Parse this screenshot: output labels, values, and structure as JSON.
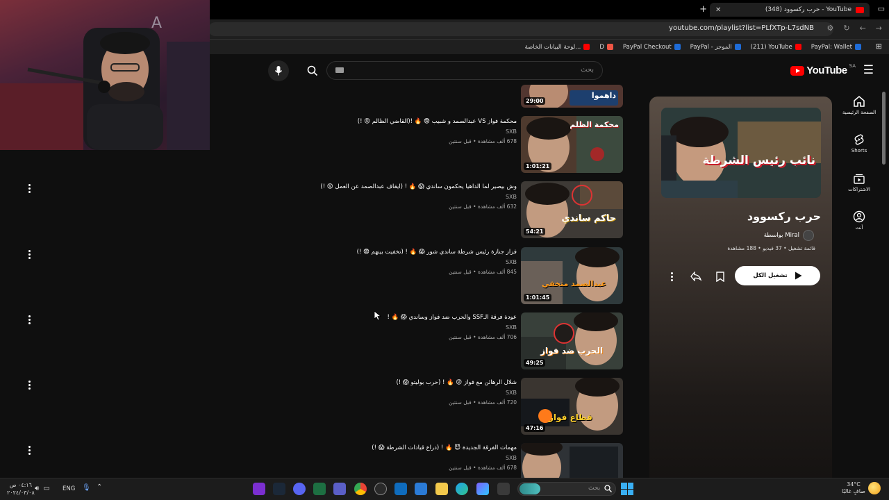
{
  "browser": {
    "tab_title": "YouTube - حرب ركسوود (348)",
    "url": "youtube.com/playlist?list=PLfXTp-L7sdNB",
    "bookmarks": [
      {
        "label": "PayPal: Wallet",
        "color": "#1e6bd6"
      },
      {
        "label": "(211) YouTube",
        "color": "#ff0000"
      },
      {
        "label": "PayPal - الموجز",
        "color": "#1e6bd6"
      },
      {
        "label": "PayPal Checkout",
        "color": "#1e6bd6"
      },
      {
        "label": "D",
        "color": "#e54"
      },
      {
        "label": "لوحة البيانات الخاصة...",
        "color": "#ff0000"
      }
    ]
  },
  "header": {
    "logo_text": "YouTube",
    "region": "SA",
    "search_placeholder": "بحث"
  },
  "nav_rail": [
    {
      "label": "الصفحة الرئيسية",
      "icon": "home-icon"
    },
    {
      "label": "Shorts",
      "icon": "shorts-icon"
    },
    {
      "label": "الاشتراكات",
      "icon": "subscriptions-icon"
    },
    {
      "label": "أنت",
      "icon": "you-icon"
    }
  ],
  "playlist": {
    "title": "حرب ركسوود",
    "owner": "بواسطة Miral",
    "meta": "قائمة تشغيل • 37 فيديو • 188 مشاهدة",
    "play_all": "تشغيل الكل",
    "thumb_caption": "نائب رئيس الشرطة"
  },
  "videos": [
    {
      "title": "",
      "channel": "",
      "meta": "",
      "duration": "29:00",
      "overlay": "داهموا"
    },
    {
      "title": "محكمة فواز VS عبدالصمد و شبيب 😨 🔥 !(القاضي الظالم 😡 !)",
      "channel": "SXB",
      "meta": "678 ألف مشاهدة • قبل سنتين",
      "duration": "1:01:21",
      "overlay": "محكمة الظلم"
    },
    {
      "title": "وش بيصير لما الداهيا يحكمون ساندي 😱 🔥 ! (ايقاف عبدالصمد عن العمل 😡 !)",
      "channel": "SXB",
      "meta": "632 ألف مشاهدة • قبل سنتين",
      "duration": "54:21",
      "overlay": "حاكم ساندي"
    },
    {
      "title": "فزاز جنازة رئيس شرطة ساندي شور 😱 🔥 ! (تخفيت بينهم 😨 !)",
      "channel": "SXB",
      "meta": "845 ألف مشاهدة • قبل سنتين",
      "duration": "1:01:45",
      "overlay": "عبدالصمد متخفي"
    },
    {
      "title": "عودة فرقة الـSSF والحرب ضد فواز وساندي 😱 🔥 !",
      "channel": "SXB",
      "meta": "706 ألف مشاهدة • قبل سنتين",
      "duration": "49:25",
      "overlay": "الحرب ضد فواز"
    },
    {
      "title": "شلال الرهائن مع فواز 😡 🔥 ! (حرب بوليتو 😱 !)",
      "channel": "SXB",
      "meta": "720 ألف مشاهدة • قبل سنتين",
      "duration": "47:16",
      "overlay": "قطاع فواز"
    },
    {
      "title": "مهمات الفرقة الجديدة 😈 🔥 ! (دراع قيادات الشرطة 😱 !)",
      "channel": "SXB",
      "meta": "678 ألف مشاهدة • قبل سنتين",
      "duration": "",
      "overlay": ""
    }
  ],
  "taskbar": {
    "search_text": "بحث",
    "time": "٠٤:١٦ ص",
    "date": "٢٠٢٤/٠٣/٠٨",
    "lang": "ENG",
    "temp": "34°C",
    "weather": "صافٍ غالبًا"
  }
}
